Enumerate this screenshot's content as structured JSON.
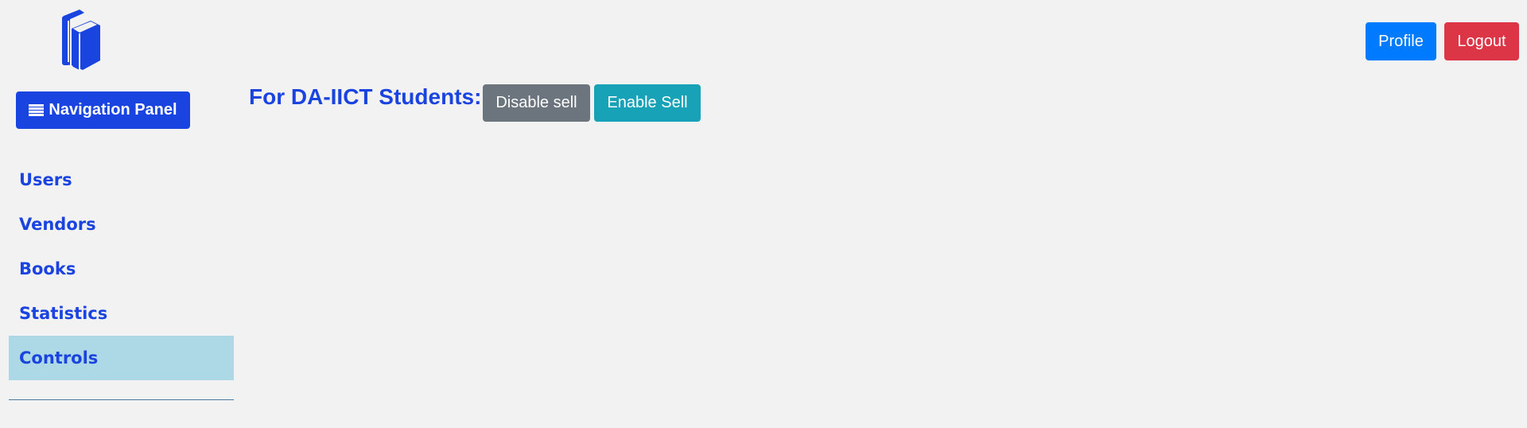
{
  "theme": {
    "accent": "#1a44e0",
    "primary": "#007bff",
    "danger": "#dc3545",
    "secondary": "#6c757d",
    "info": "#17a2b8",
    "active_bg": "#add8e6",
    "divider": "#4a7a9a"
  },
  "header": {
    "logo_icon": "books-icon",
    "profile_label": "Profile",
    "logout_label": "Logout"
  },
  "nav": {
    "toggle_icon": "hamburger-icon",
    "toggle_label": "Navigation Panel",
    "items": [
      {
        "label": "Users",
        "active": false
      },
      {
        "label": "Vendors",
        "active": false
      },
      {
        "label": "Books",
        "active": false
      },
      {
        "label": "Statistics",
        "active": false
      },
      {
        "label": "Controls",
        "active": true
      }
    ]
  },
  "controls": {
    "label": "For DA-IICT Students:",
    "disable_label": "Disable sell",
    "enable_label": "Enable Sell"
  }
}
